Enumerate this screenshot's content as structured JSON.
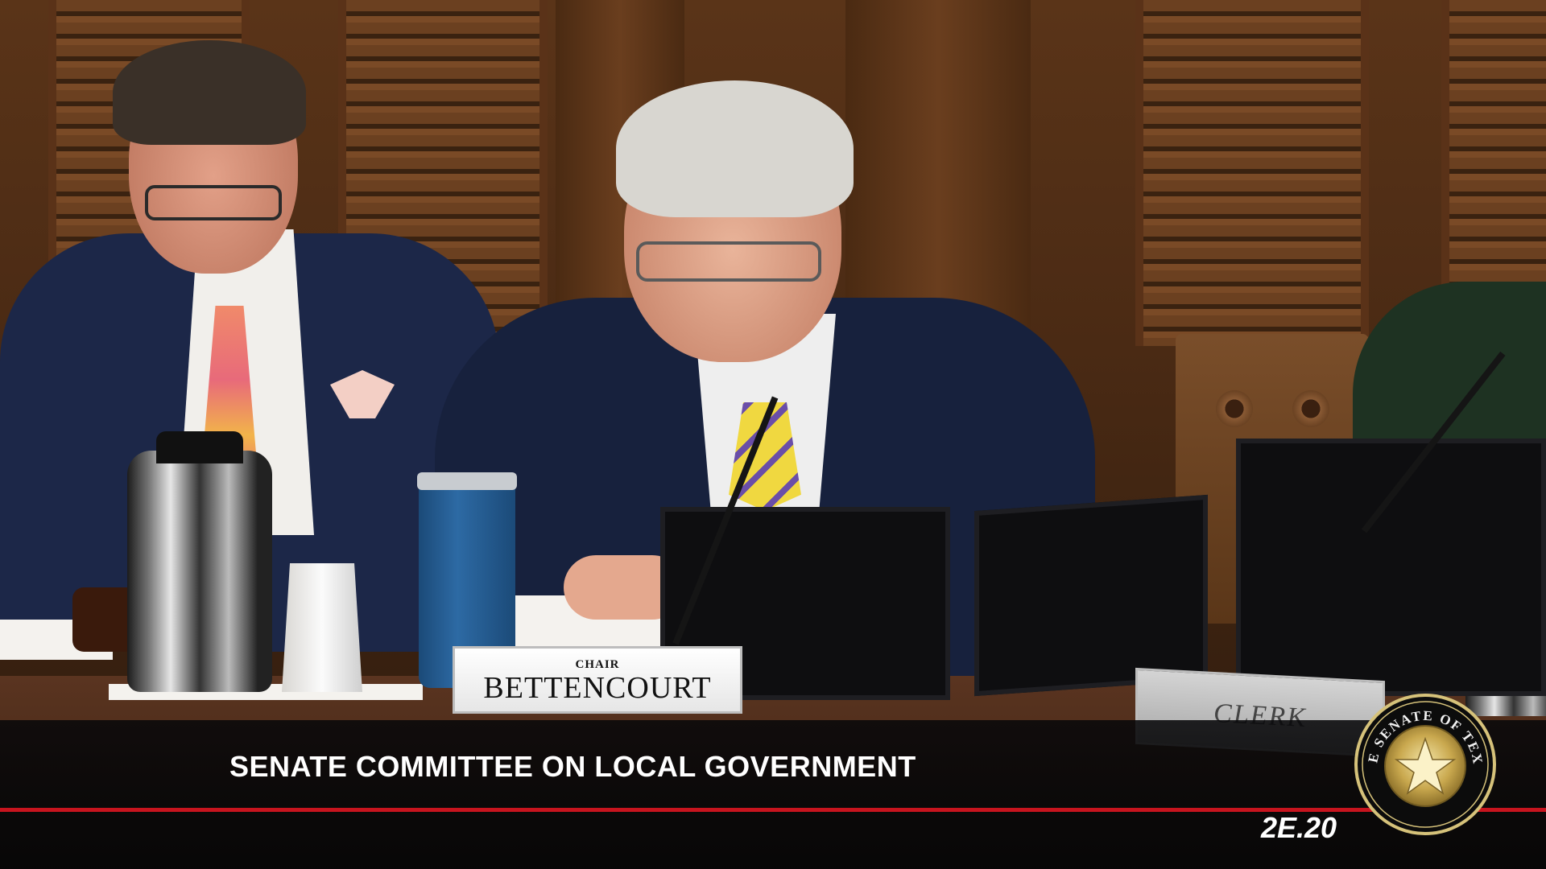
{
  "broadcast": {
    "caption": "SENATE COMMITTEE ON LOCAL GOVERNMENT",
    "room": "2E.20",
    "accent_color": "#c8141e"
  },
  "name_plates": {
    "chair_title": "CHAIR",
    "chair_name": "BETTENCOURT",
    "clerk": "CLERK"
  },
  "seal": {
    "text": "THE SENATE OF TEXAS"
  }
}
